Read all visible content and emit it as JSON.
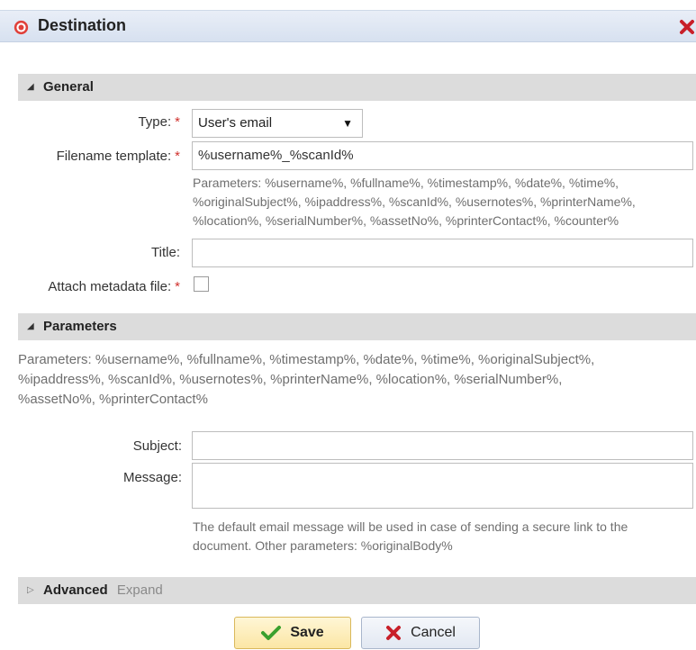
{
  "dialog": {
    "title": "Destination",
    "icon": "target-icon",
    "close_icon": "close-icon"
  },
  "general": {
    "header": "General",
    "type_label": "Type:",
    "type_value": "User's email",
    "filename_label": "Filename template:",
    "filename_value": "%username%_%scanId%",
    "filename_hint_lines": [
      "Parameters: %username%, %fullname%, %timestamp%, %date%, %time%,",
      "%originalSubject%, %ipaddress%, %scanId%, %usernotes%, %printerName%,",
      "%location%, %serialNumber%, %assetNo%, %printerContact%, %counter%"
    ],
    "title_label": "Title:",
    "title_value": "",
    "attach_label": "Attach metadata file:",
    "attach_checked": false,
    "required_marker": "*"
  },
  "parameters": {
    "header": "Parameters",
    "description_lines": [
      "Parameters: %username%, %fullname%, %timestamp%, %date%, %time%, %originalSubject%,",
      "%ipaddress%, %scanId%, %usernotes%, %printerName%, %location%, %serialNumber%,",
      "%assetNo%, %printerContact%"
    ],
    "subject_label": "Subject:",
    "subject_value": "",
    "message_label": "Message:",
    "message_value": "",
    "message_hint_lines": [
      "The default email message will be used in case of sending a secure link to the",
      "document. Other parameters: %originalBody%"
    ]
  },
  "advanced": {
    "header": "Advanced",
    "expand_label": "Expand"
  },
  "footer": {
    "save_label": "Save",
    "cancel_label": "Cancel"
  },
  "colors": {
    "required": "#d0312d",
    "save_check": "#3aa02e",
    "cancel_x": "#c8202a",
    "title_icon": "#e0413a"
  }
}
